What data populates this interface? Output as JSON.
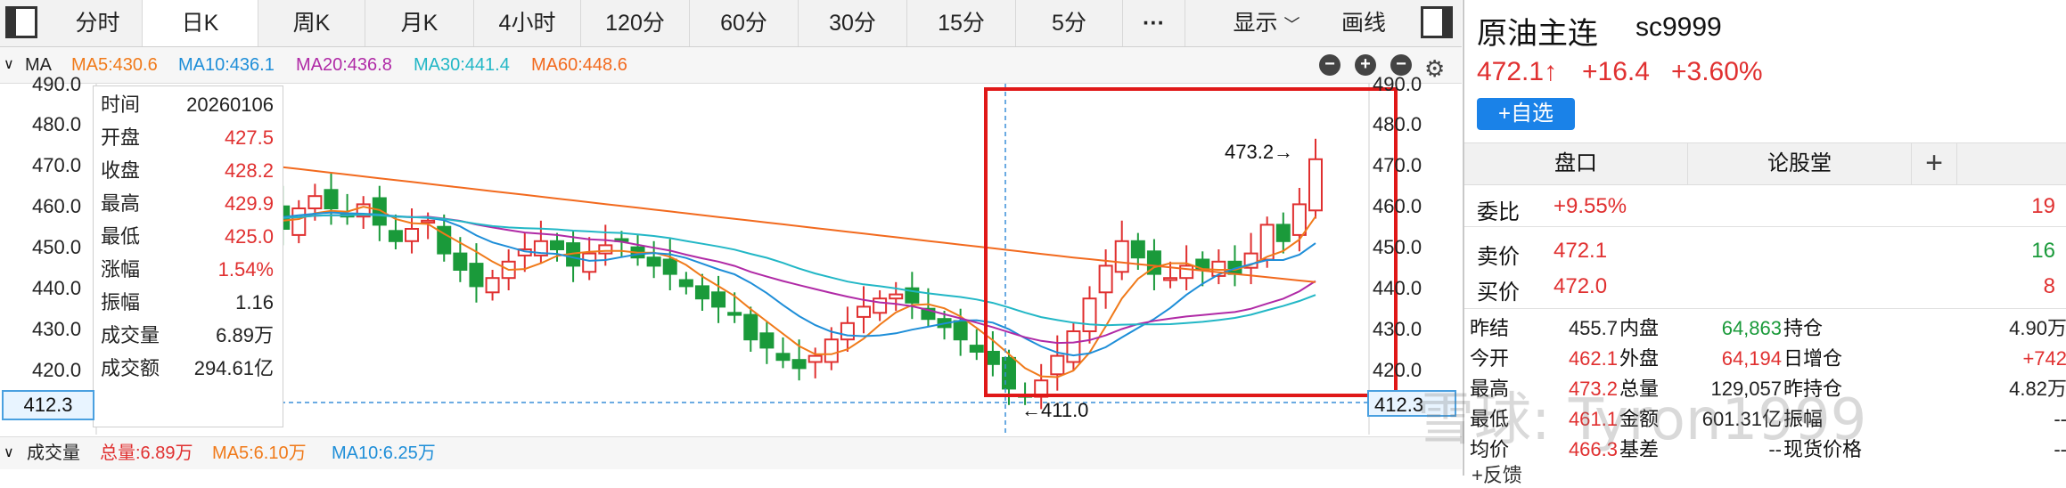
{
  "toolbar": {
    "tabs": [
      "分时",
      "日K",
      "周K",
      "月K",
      "4小时",
      "120分",
      "60分",
      "30分",
      "15分",
      "5分",
      "···"
    ],
    "active_tab": "日K",
    "display_label": "显示",
    "draw_label": "画线"
  },
  "ma_line": {
    "label": "MA",
    "ma5": "MA5:430.6",
    "ma10": "MA10:436.1",
    "ma20": "MA20:436.8",
    "ma30": "MA30:441.4",
    "ma60": "MA60:448.6",
    "colors": {
      "ma5": "#f07a1a",
      "ma10": "#1e8ed8",
      "ma20": "#b02aa6",
      "ma30": "#22b7c6",
      "ma60": "#f26a1e"
    }
  },
  "chart": {
    "y_ticks": [
      "490.0",
      "480.0",
      "470.0",
      "460.0",
      "450.0",
      "440.0",
      "430.0",
      "420.0"
    ],
    "cursor_price": "412.3",
    "high_label": "473.2→",
    "low_label": "←411.0",
    "up_color": "#e03030",
    "down_color": "#1a9a3a"
  },
  "info": {
    "rows": [
      {
        "k": "时间",
        "v": "20260106",
        "c": "dark"
      },
      {
        "k": "开盘",
        "v": "427.5",
        "c": "red"
      },
      {
        "k": "收盘",
        "v": "428.2",
        "c": "red"
      },
      {
        "k": "最高",
        "v": "429.9",
        "c": "red"
      },
      {
        "k": "最低",
        "v": "425.0",
        "c": "red"
      },
      {
        "k": "涨幅",
        "v": "1.54%",
        "c": "red"
      },
      {
        "k": "振幅",
        "v": "1.16",
        "c": "dark"
      },
      {
        "k": "成交量",
        "v": "6.89万",
        "c": "dark"
      },
      {
        "k": "成交额",
        "v": "294.61亿",
        "c": "dark"
      }
    ]
  },
  "volume": {
    "label": "成交量",
    "total": "总量:6.89万",
    "ma5": "MA5:6.10万",
    "ma10": "MA10:6.25万"
  },
  "quote": {
    "name": "原油主连",
    "code": "sc9999",
    "price": "472.1↑",
    "change": "+16.4",
    "change_pct": "+3.60%",
    "watch_button": "+自选",
    "tabs": [
      "盘口",
      "论股堂"
    ],
    "plus": "+",
    "weibi_label": "委比",
    "weibi_value": "+9.55%",
    "weibi_count": "19",
    "ask_label": "卖价",
    "ask_price": "472.1",
    "ask_vol": "16",
    "bid_label": "买价",
    "bid_price": "472.0",
    "bid_vol": "8",
    "stats": [
      [
        "昨结",
        "455.7",
        "内盘",
        "64,863",
        "持仓",
        "4.90万"
      ],
      [
        "今开",
        "462.1",
        "外盘",
        "64,194",
        "日增仓",
        "+742"
      ],
      [
        "最高",
        "473.2",
        "总量",
        "129,057",
        "昨持仓",
        "4.82万"
      ],
      [
        "最低",
        "461.1",
        "金额",
        "601.31亿",
        "振幅",
        "--"
      ],
      [
        "均价",
        "466.3",
        "基差",
        "--",
        "现货价格",
        "--"
      ]
    ],
    "more": "+反馈"
  },
  "watermark": "雪球: Tyron1999"
}
